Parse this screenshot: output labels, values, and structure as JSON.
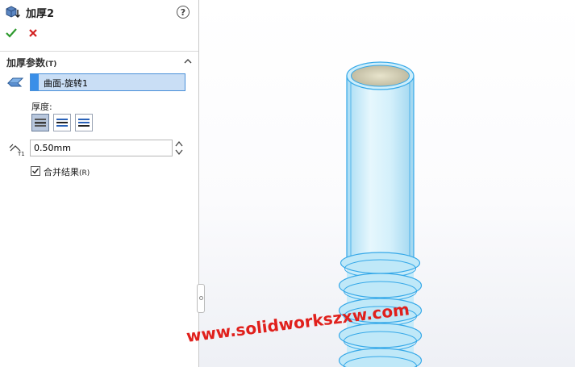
{
  "header": {
    "title": "加厚2",
    "help_glyph": "?"
  },
  "actions": {
    "ok": "confirm-check-icon",
    "cancel": "cancel-x-icon"
  },
  "group": {
    "title": "加厚参数",
    "hotkey": "(T)",
    "selection": "曲面-旋转1",
    "thickness_label": "厚度:",
    "thickness_value": "0.50mm",
    "merge_label": "合并结果",
    "merge_hotkey": "(R)",
    "merge_checked": true
  },
  "watermark": "www.solidworkszxw.com",
  "colors": {
    "selection_bg": "#c9def5",
    "swatch": "#3a8fe8",
    "model_edge": "#35a8e8",
    "watermark": "#e0201c"
  }
}
